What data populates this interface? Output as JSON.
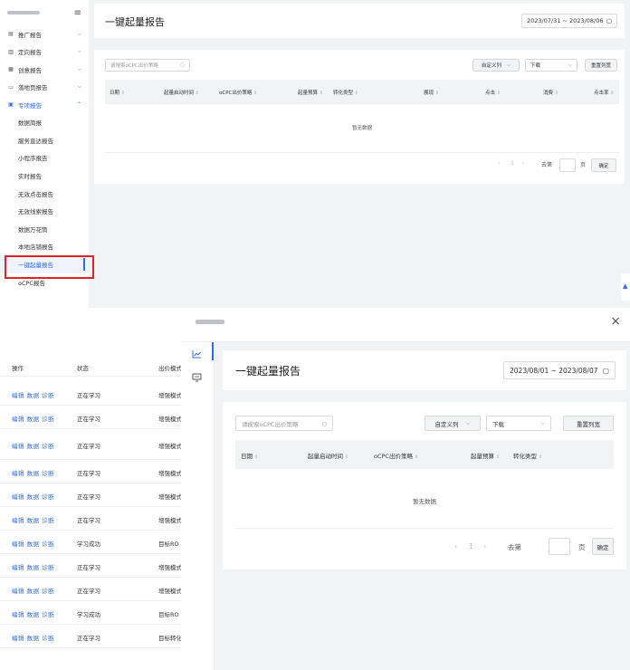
{
  "top": {
    "sidebar": {
      "menu_icon": "≡",
      "items": [
        {
          "label": "推广报告",
          "icon": "▤"
        },
        {
          "label": "定向报告",
          "icon": "▥"
        },
        {
          "label": "创意报告",
          "icon": "▦"
        },
        {
          "label": "落地页报告",
          "icon": "▭"
        },
        {
          "label": "专项报告",
          "icon": "▣"
        }
      ],
      "sub_items": [
        "数据简报",
        "服务直达报告",
        "小程序报告",
        "实时报告",
        "无效点击报告",
        "无效线索报告",
        "数据万花筒",
        "本地店铺报告",
        "一键起量报告",
        "oCPC报告"
      ]
    },
    "page_title": "一键起量报告",
    "date_range": "2023/07/31 ~ 2023/08/06",
    "search_placeholder": "请搜索oCPC出价策略",
    "custom_columns": "自定义列",
    "download": "下载",
    "reset_columns": "重置列宽",
    "columns": [
      "日期",
      "起量启动时间",
      "oCPC出价策略",
      "起量预算",
      "转化类型",
      "展现",
      "点击",
      "消费",
      "点击率"
    ],
    "empty_text": "暂无数据",
    "pager": {
      "prev": "‹",
      "page": "1",
      "next": "›",
      "goto": "去第",
      "unit": "页",
      "confirm": "确定"
    }
  },
  "bottom_table": {
    "headers": [
      "操作",
      "状态",
      "出价模式"
    ],
    "rows": [
      {
        "ops": "编辑 数据 诊断",
        "status": "正在学习",
        "mode": "增强模式"
      },
      {
        "ops": "编辑 数据 诊断",
        "status": "正在学习",
        "mode": "增强模式"
      },
      {
        "ops": "编辑 数据 诊断",
        "status": "正在学习",
        "mode": "增强模式"
      },
      {
        "ops": "编辑 数据 诊断",
        "status": "正在学习",
        "mode": "增强模式"
      },
      {
        "ops": "编辑 数据 诊断",
        "status": "正在学习",
        "mode": "增强模式"
      },
      {
        "ops": "编辑 数据 诊断",
        "status": "正在学习",
        "mode": "增强模式"
      },
      {
        "ops": "编辑 数据 诊断",
        "status": "学习成功",
        "mode": "目标RO"
      },
      {
        "ops": "编辑 数据 诊断",
        "status": "正在学习",
        "mode": "增强模式"
      },
      {
        "ops": "编辑 数据 诊断",
        "status": "正在学习",
        "mode": "增强模式"
      },
      {
        "ops": "编辑 数据 诊断",
        "status": "学习成功",
        "mode": "目标RO"
      },
      {
        "ops": "编辑 数据 诊断",
        "status": "正在学习",
        "mode": "目标转化"
      }
    ]
  },
  "modal": {
    "close": "×",
    "title": "一键起量报告",
    "date_range": "2023/08/01 ~ 2023/08/07",
    "search_placeholder": "请搜索oCPC出价策略",
    "custom_columns": "自定义列",
    "download": "下载",
    "reset_columns": "重置列宽",
    "columns": [
      "日期",
      "起量启动时间",
      "oCPC出价策略",
      "起量预算",
      "转化类型"
    ],
    "empty_text": "暂无数据",
    "pager": {
      "prev": "‹",
      "page": "1",
      "next": "›",
      "goto": "去第",
      "unit": "页",
      "confirm": "确定"
    }
  }
}
